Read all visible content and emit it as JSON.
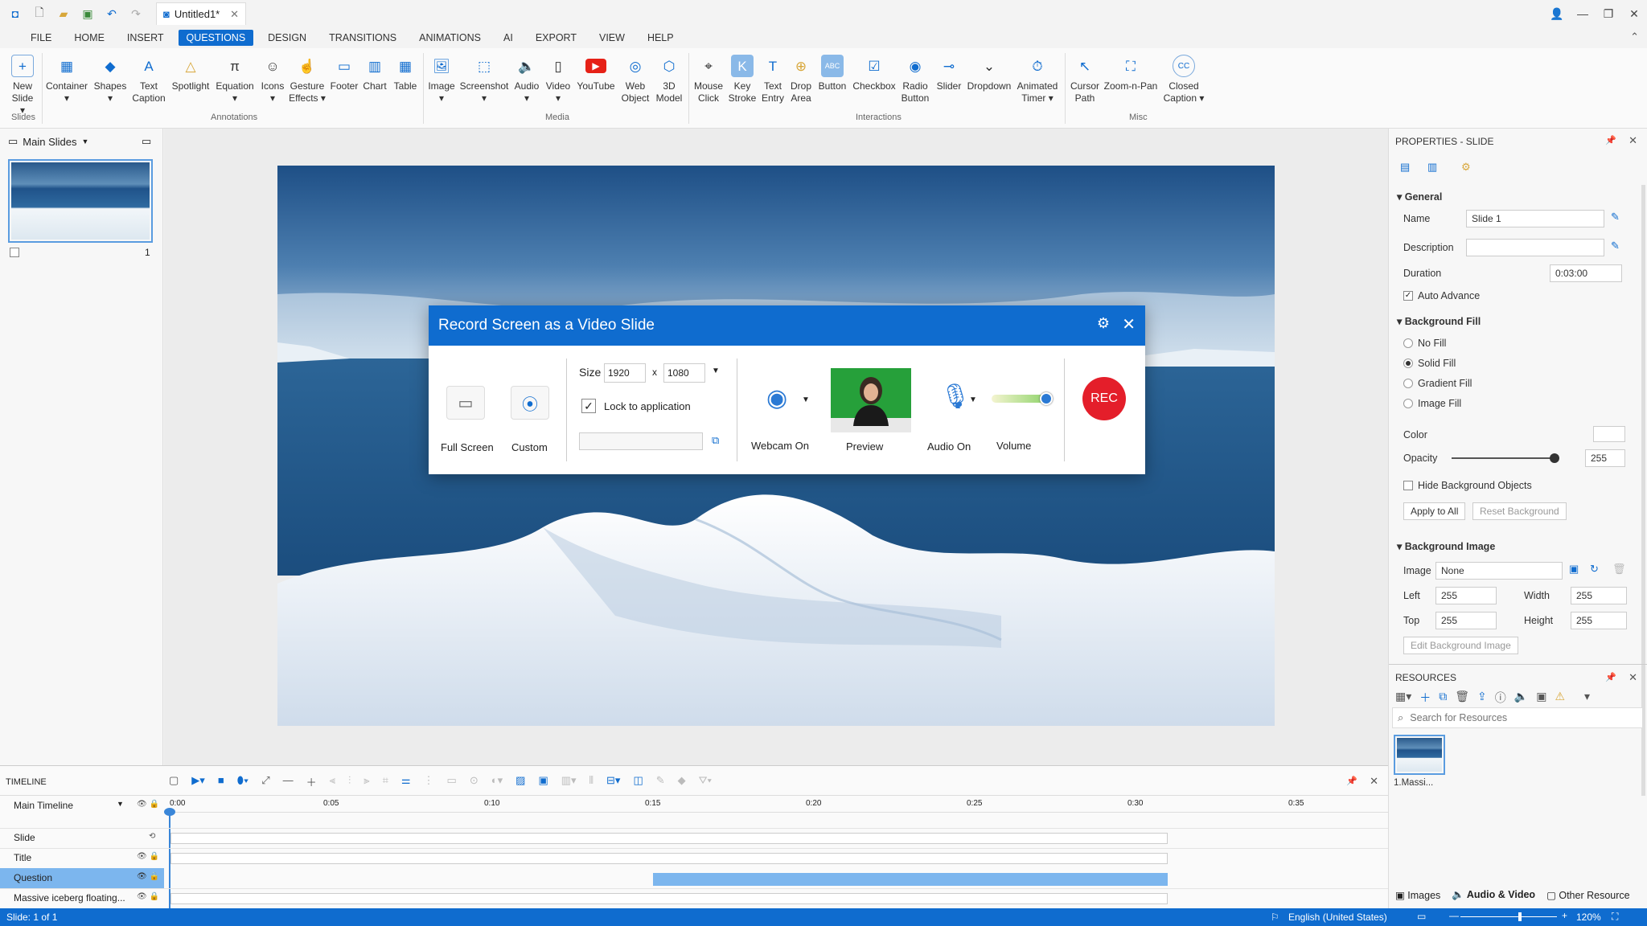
{
  "window": {
    "tab_title": "Untitled1*"
  },
  "menu": [
    "FILE",
    "HOME",
    "INSERT",
    "QUESTIONS",
    "DESIGN",
    "TRANSITIONS",
    "ANIMATIONS",
    "AI",
    "EXPORT",
    "VIEW",
    "HELP"
  ],
  "ribbon": {
    "items": [
      {
        "l1": "New",
        "l2": "Slide ▾"
      },
      {
        "l1": "Container",
        "l2": "▾"
      },
      {
        "l1": "Shapes",
        "l2": "▾"
      },
      {
        "l1": "Text",
        "l2": "Caption"
      },
      {
        "l1": "Spotlight",
        "l2": ""
      },
      {
        "l1": "Equation",
        "l2": "▾"
      },
      {
        "l1": "Icons",
        "l2": "▾"
      },
      {
        "l1": "Gesture",
        "l2": "Effects ▾"
      },
      {
        "l1": "Footer",
        "l2": ""
      },
      {
        "l1": "Chart",
        "l2": ""
      },
      {
        "l1": "Table",
        "l2": ""
      },
      {
        "l1": "Image",
        "l2": "▾"
      },
      {
        "l1": "Screenshot",
        "l2": "▾"
      },
      {
        "l1": "Audio",
        "l2": "▾"
      },
      {
        "l1": "Video",
        "l2": "▾"
      },
      {
        "l1": "YouTube",
        "l2": ""
      },
      {
        "l1": "Web",
        "l2": "Object"
      },
      {
        "l1": "3D",
        "l2": "Model"
      },
      {
        "l1": "Mouse",
        "l2": "Click"
      },
      {
        "l1": "Key",
        "l2": "Stroke"
      },
      {
        "l1": "Text",
        "l2": "Entry"
      },
      {
        "l1": "Drop",
        "l2": "Area"
      },
      {
        "l1": "Button",
        "l2": ""
      },
      {
        "l1": "Checkbox",
        "l2": ""
      },
      {
        "l1": "Radio",
        "l2": "Button"
      },
      {
        "l1": "Slider",
        "l2": ""
      },
      {
        "l1": "Dropdown",
        "l2": ""
      },
      {
        "l1": "Animated",
        "l2": "Timer ▾"
      },
      {
        "l1": "Cursor",
        "l2": "Path"
      },
      {
        "l1": "Zoom-n-Pan",
        "l2": ""
      },
      {
        "l1": "Closed",
        "l2": "Caption ▾"
      }
    ],
    "groups": [
      "Slides",
      "Annotations",
      "Media",
      "Interactions",
      "Misc"
    ]
  },
  "left_panel": {
    "title": "Main Slides",
    "thumb_number": "1"
  },
  "dialog": {
    "title": "Record Screen as a Video Slide",
    "full_screen": "Full Screen",
    "custom": "Custom",
    "size_label": "Size",
    "width": "1920",
    "x": "x",
    "height": "1080",
    "lock": "Lock to application",
    "webcam": "Webcam On",
    "preview": "Preview",
    "audio": "Audio On",
    "volume": "Volume",
    "rec": "REC"
  },
  "properties": {
    "title": "PROPERTIES - SLIDE",
    "general": "General",
    "name_label": "Name",
    "name_value": "Slide 1",
    "description_label": "Description",
    "duration_label": "Duration",
    "duration_value": "0:03:00",
    "auto_advance": "Auto Advance",
    "bg_fill": "Background Fill",
    "no_fill": "No Fill",
    "solid_fill": "Solid Fill",
    "gradient_fill": "Gradient Fill",
    "image_fill": "Image Fill",
    "color_label": "Color",
    "opacity_label": "Opacity",
    "opacity_value": "255",
    "hide_bg": "Hide Background Objects",
    "apply_all": "Apply to All",
    "reset_bg": "Reset Background",
    "bg_image": "Background Image",
    "image_label": "Image",
    "image_value": "None",
    "left_label": "Left",
    "left_value": "255",
    "width_label": "Width",
    "width_value": "255",
    "top_label": "Top",
    "top_value": "255",
    "height_label": "Height",
    "height_value": "255",
    "edit_bg": "Edit Background Image"
  },
  "resources": {
    "title": "RESOURCES",
    "search_placeholder": "Search for Resources",
    "item": "1.Massi...",
    "tabs": [
      "Images",
      "Audio & Video",
      "Other Resource"
    ]
  },
  "timeline": {
    "title": "TIMELINE",
    "main": "Main Timeline",
    "ticks": [
      "0:00",
      "0:05",
      "0:10",
      "0:15",
      "0:20",
      "0:25",
      "0:30",
      "0:35"
    ],
    "rows": [
      "Slide",
      "Title",
      "Question",
      "Massive iceberg floating..."
    ]
  },
  "status": {
    "left": "Slide: 1 of 1",
    "lang": "English (United States)",
    "zoom": "120%"
  }
}
